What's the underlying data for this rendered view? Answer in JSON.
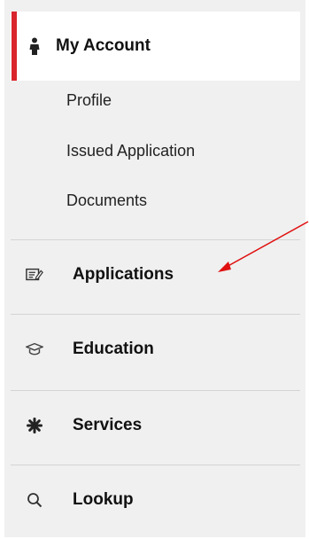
{
  "nav": {
    "account": {
      "label": "My Account",
      "icon": "person-icon",
      "sub_items": [
        "Profile",
        "Issued Application",
        "Documents"
      ]
    },
    "items": [
      {
        "label": "Applications",
        "icon": "form-edit-icon"
      },
      {
        "label": "Education",
        "icon": "graduation-cap-icon"
      },
      {
        "label": "Services",
        "icon": "asterisk-icon"
      },
      {
        "label": "Lookup",
        "icon": "search-icon"
      }
    ]
  },
  "colors": {
    "accent": "#d9262c",
    "panel_bg": "#f0f0f0",
    "active_bg": "#ffffff",
    "divider": "#d4d4d4",
    "annotation_arrow": "#e01010"
  }
}
